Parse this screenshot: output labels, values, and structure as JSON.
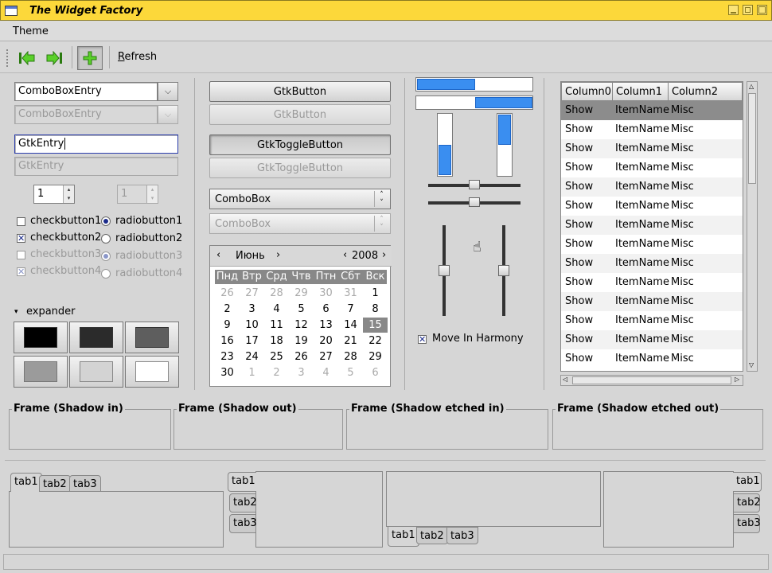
{
  "window": {
    "title": "The Widget Factory"
  },
  "menu": {
    "theme": "Theme"
  },
  "toolbar": {
    "refresh_label_first": "R",
    "refresh_label_rest": "efresh"
  },
  "left": {
    "combo_entry": "ComboBoxEntry",
    "combo_entry_disabled": "ComboBoxEntry",
    "entry": "GtkEntry",
    "entry_disabled": "GtkEntry",
    "spin": "1",
    "spin_disabled": "1",
    "checks": [
      "checkbutton1",
      "checkbutton2",
      "checkbutton3",
      "checkbutton4"
    ],
    "radios": [
      "radiobutton1",
      "radiobutton2",
      "radiobutton3",
      "radiobutton4"
    ],
    "expander": "expander",
    "swatches": [
      "#000000",
      "#2b2b2b",
      "#5e5e5e",
      "#9b9b9b",
      "#d3d3d3",
      "#ffffff"
    ]
  },
  "middle": {
    "button": "GtkButton",
    "button_disabled": "GtkButton",
    "toggle": "GtkToggleButton",
    "toggle_disabled": "GtkToggleButton",
    "combo": "ComboBox",
    "combo_disabled": "ComboBox",
    "calendar": {
      "month": "Июнь",
      "year": "2008",
      "weekdays": [
        "Пнд",
        "Втр",
        "Срд",
        "Чтв",
        "Птн",
        "Сбт",
        "Вск"
      ],
      "weeks": [
        [
          "26",
          "27",
          "28",
          "29",
          "30",
          "31",
          "1"
        ],
        [
          "2",
          "3",
          "4",
          "5",
          "6",
          "7",
          "8"
        ],
        [
          "9",
          "10",
          "11",
          "12",
          "13",
          "14",
          "15"
        ],
        [
          "16",
          "17",
          "18",
          "19",
          "20",
          "21",
          "22"
        ],
        [
          "23",
          "24",
          "25",
          "26",
          "27",
          "28",
          "29"
        ],
        [
          "30",
          "1",
          "2",
          "3",
          "4",
          "5",
          "6"
        ]
      ],
      "selected": "15"
    }
  },
  "sliders": {
    "progress_h": [
      0.5,
      0.5
    ],
    "progress_v": [
      0.5,
      0.5
    ],
    "move_in_harmony": "Move In Harmony"
  },
  "tree": {
    "columns": [
      "Column0",
      "Column1",
      "Column2"
    ],
    "rows": [
      [
        "Show",
        "ItemName",
        "Misc"
      ],
      [
        "Show",
        "ItemName",
        "Misc"
      ],
      [
        "Show",
        "ItemName",
        "Misc"
      ],
      [
        "Show",
        "ItemName",
        "Misc"
      ],
      [
        "Show",
        "ItemName",
        "Misc"
      ],
      [
        "Show",
        "ItemName",
        "Misc"
      ],
      [
        "Show",
        "ItemName",
        "Misc"
      ],
      [
        "Show",
        "ItemName",
        "Misc"
      ],
      [
        "Show",
        "ItemName",
        "Misc"
      ],
      [
        "Show",
        "ItemName",
        "Misc"
      ],
      [
        "Show",
        "ItemName",
        "Misc"
      ],
      [
        "Show",
        "ItemName",
        "Misc"
      ],
      [
        "Show",
        "ItemName",
        "Misc"
      ],
      [
        "Show",
        "ItemName",
        "Misc"
      ]
    ]
  },
  "frames": [
    "Frame (Shadow in)",
    "Frame (Shadow out)",
    "Frame (Shadow etched in)",
    "Frame (Shadow etched out)"
  ],
  "tabs": [
    "tab1",
    "tab2",
    "tab3"
  ],
  "colors": {
    "titlebar": "#fcd83a",
    "accent": "#3a8ef0",
    "selection": "#888888"
  }
}
